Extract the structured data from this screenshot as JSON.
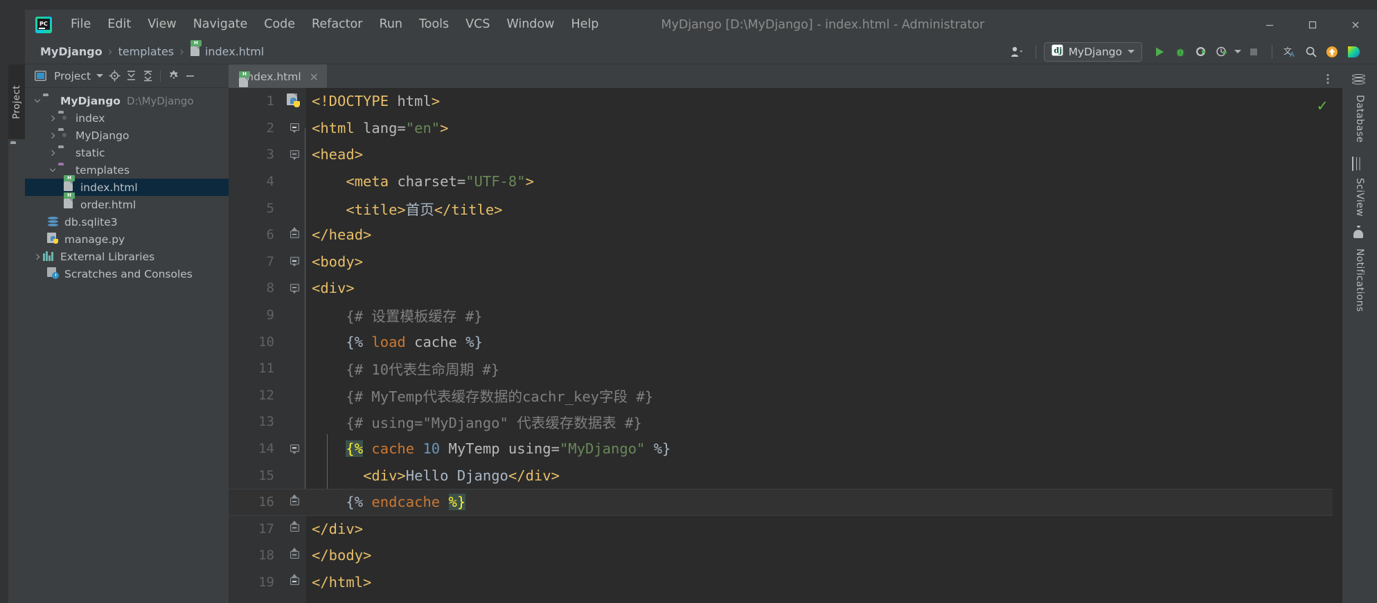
{
  "window": {
    "title": "MyDjango [D:\\MyDjango] - index.html - Administrator",
    "minimize": "–",
    "maximize": "□",
    "close": "✕",
    "logo_icon": "pycharm-logo-icon"
  },
  "menu": {
    "items": [
      {
        "label": "File",
        "mnemonic": "F"
      },
      {
        "label": "Edit",
        "mnemonic": "E"
      },
      {
        "label": "View",
        "mnemonic": "V"
      },
      {
        "label": "Navigate",
        "mnemonic": "N"
      },
      {
        "label": "Code",
        "mnemonic": "C"
      },
      {
        "label": "Refactor",
        "mnemonic": "R"
      },
      {
        "label": "Run",
        "mnemonic": "u"
      },
      {
        "label": "Tools",
        "mnemonic": "T"
      },
      {
        "label": "VCS",
        "mnemonic": "S"
      },
      {
        "label": "Window",
        "mnemonic": "W"
      },
      {
        "label": "Help",
        "mnemonic": "H"
      }
    ]
  },
  "breadcrumb": {
    "separator": "›",
    "items": [
      {
        "label": "MyDjango",
        "bold": true,
        "icon": ""
      },
      {
        "label": "templates",
        "bold": false,
        "icon": ""
      },
      {
        "label": "index.html",
        "bold": false,
        "icon": "html-file-icon"
      }
    ]
  },
  "toolbar": {
    "user_icon": "user-account-icon",
    "run_config": {
      "label": "MyDjango",
      "icon": "django-config-icon"
    },
    "run_icon": "run-play-icon",
    "debug_icon": "debug-bug-icon",
    "coverage_icon": "run-coverage-icon",
    "profile_icon": "run-profiler-icon",
    "stop_icon": "stop-icon",
    "translate_icon": "translate-icon",
    "search_icon": "search-everywhere-icon",
    "update_icon": "update-project-icon",
    "ide_icon": "ide-feature-icon"
  },
  "left_strip": {
    "tab_label": "Project",
    "folder_icon": "folder-icon"
  },
  "project_panel": {
    "header": {
      "title": "Project",
      "project_icon": "project-view-icon",
      "dropdown_icon": "chevron-down-icon",
      "locate_icon": "scroll-from-source-icon",
      "expand_icon": "expand-all-icon",
      "collapse_icon": "collapse-all-icon",
      "settings_icon": "gear-icon",
      "hide_icon": "minimize-icon"
    },
    "tree": [
      {
        "label": "MyDjango",
        "path": "D:\\MyDjango",
        "indent": 0,
        "arrow": "open",
        "icon": "folder-icon",
        "bold": true,
        "selected": false
      },
      {
        "label": "index",
        "path": "",
        "indent": 1,
        "arrow": "closed",
        "icon": "module-folder-icon",
        "bold": false,
        "selected": false
      },
      {
        "label": "MyDjango",
        "path": "",
        "indent": 1,
        "arrow": "closed",
        "icon": "module-folder-icon",
        "bold": false,
        "selected": false
      },
      {
        "label": "static",
        "path": "",
        "indent": 1,
        "arrow": "closed",
        "icon": "folder-icon",
        "bold": false,
        "selected": false
      },
      {
        "label": "templates",
        "path": "",
        "indent": 1,
        "arrow": "open",
        "icon": "templates-folder-icon",
        "bold": false,
        "selected": false
      },
      {
        "label": "index.html",
        "path": "",
        "indent": 2,
        "arrow": "none",
        "icon": "html-file-icon",
        "bold": false,
        "selected": true
      },
      {
        "label": "order.html",
        "path": "",
        "indent": 2,
        "arrow": "none",
        "icon": "html-file-icon",
        "bold": false,
        "selected": false
      },
      {
        "label": "db.sqlite3",
        "path": "",
        "indent": 1,
        "arrow": "none",
        "icon": "database-file-icon",
        "bold": false,
        "selected": false
      },
      {
        "label": "manage.py",
        "path": "",
        "indent": 1,
        "arrow": "none",
        "icon": "python-file-icon",
        "bold": false,
        "selected": false
      },
      {
        "label": "External Libraries",
        "path": "",
        "indent": 0,
        "arrow": "closed",
        "icon": "external-libraries-icon",
        "bold": false,
        "selected": false
      },
      {
        "label": "Scratches and Consoles",
        "path": "",
        "indent": 0,
        "arrow": "none",
        "icon": "scratches-icon",
        "bold": false,
        "selected": false
      }
    ]
  },
  "editor": {
    "tab": {
      "label": "index.html",
      "icon": "html-file-icon",
      "close": "✕"
    },
    "more_icon": "more-options-icon",
    "inspection_status": "✓",
    "lines": [
      {
        "num": "1",
        "fold": "none",
        "gutter": "django-python-icon",
        "caret": false,
        "tokens": [
          {
            "t": "<!DOCTYPE ",
            "c": "s-tag"
          },
          {
            "t": "html",
            "c": "s-attr"
          },
          {
            "t": ">",
            "c": "s-tag"
          }
        ]
      },
      {
        "num": "2",
        "fold": "down",
        "gutter": "",
        "caret": false,
        "tokens": [
          {
            "t": "<html ",
            "c": "s-tag"
          },
          {
            "t": "lang=",
            "c": "s-attr"
          },
          {
            "t": "\"en\"",
            "c": "s-val"
          },
          {
            "t": ">",
            "c": "s-tag"
          }
        ]
      },
      {
        "num": "3",
        "fold": "down",
        "gutter": "",
        "caret": false,
        "tokens": [
          {
            "t": "<head>",
            "c": "s-tag"
          }
        ]
      },
      {
        "num": "4",
        "fold": "none",
        "gutter": "",
        "caret": false,
        "tokens": [
          {
            "t": "    ",
            "c": "s-txt"
          },
          {
            "t": "<meta ",
            "c": "s-tag"
          },
          {
            "t": "charset=",
            "c": "s-attr"
          },
          {
            "t": "\"UTF-8\"",
            "c": "s-val"
          },
          {
            "t": ">",
            "c": "s-tag"
          }
        ]
      },
      {
        "num": "5",
        "fold": "none",
        "gutter": "",
        "caret": false,
        "tokens": [
          {
            "t": "    ",
            "c": "s-txt"
          },
          {
            "t": "<title>",
            "c": "s-tag"
          },
          {
            "t": "首页",
            "c": "s-txt"
          },
          {
            "t": "</title>",
            "c": "s-tag"
          }
        ]
      },
      {
        "num": "6",
        "fold": "up",
        "gutter": "",
        "caret": false,
        "tokens": [
          {
            "t": "</head>",
            "c": "s-tag"
          }
        ]
      },
      {
        "num": "7",
        "fold": "down",
        "gutter": "",
        "caret": false,
        "tokens": [
          {
            "t": "<body>",
            "c": "s-tag"
          }
        ]
      },
      {
        "num": "8",
        "fold": "down",
        "gutter": "",
        "caret": false,
        "tokens": [
          {
            "t": "<div>",
            "c": "s-tag"
          }
        ]
      },
      {
        "num": "9",
        "fold": "none",
        "gutter": "",
        "caret": false,
        "tokens": [
          {
            "t": "    {# 设置模板缓存 #}",
            "c": "s-com"
          }
        ]
      },
      {
        "num": "10",
        "fold": "none",
        "gutter": "",
        "caret": false,
        "tokens": [
          {
            "t": "    {% ",
            "c": "s-brace"
          },
          {
            "t": "load",
            "c": "s-kw"
          },
          {
            "t": " cache ",
            "c": "s-attr"
          },
          {
            "t": "%}",
            "c": "s-brace"
          }
        ]
      },
      {
        "num": "11",
        "fold": "none",
        "gutter": "",
        "caret": false,
        "tokens": [
          {
            "t": "    {# 10代表生命周期 #}",
            "c": "s-com"
          }
        ]
      },
      {
        "num": "12",
        "fold": "none",
        "gutter": "",
        "caret": false,
        "tokens": [
          {
            "t": "    {# MyTemp代表缓存数据的cachr_key字段 #}",
            "c": "s-com"
          }
        ]
      },
      {
        "num": "13",
        "fold": "none",
        "gutter": "",
        "caret": false,
        "tokens": [
          {
            "t": "    {# using=\"MyDjango\" 代表缓存数据表 #}",
            "c": "s-com"
          }
        ]
      },
      {
        "num": "14",
        "fold": "down",
        "gutter": "",
        "caret": false,
        "tokens": [
          {
            "t": "    ",
            "c": "s-txt"
          },
          {
            "t": "{%",
            "c": "hl-brace"
          },
          {
            "t": " ",
            "c": "s-txt"
          },
          {
            "t": "cache",
            "c": "s-kw"
          },
          {
            "t": " ",
            "c": "s-txt"
          },
          {
            "t": "10",
            "c": "s-num"
          },
          {
            "t": " MyTemp using=",
            "c": "s-attr"
          },
          {
            "t": "\"MyDjango\"",
            "c": "s-val"
          },
          {
            "t": " ",
            "c": "s-txt"
          },
          {
            "t": "%}",
            "c": "s-brace"
          }
        ]
      },
      {
        "num": "15",
        "fold": "none",
        "gutter": "",
        "caret": false,
        "tokens": [
          {
            "t": "      ",
            "c": "s-txt"
          },
          {
            "t": "<div>",
            "c": "s-tag"
          },
          {
            "t": "Hello Django",
            "c": "s-txt"
          },
          {
            "t": "</div>",
            "c": "s-tag"
          }
        ]
      },
      {
        "num": "16",
        "fold": "up",
        "gutter": "",
        "caret": true,
        "tokens": [
          {
            "t": "    {% ",
            "c": "s-brace"
          },
          {
            "t": "endcache",
            "c": "s-kw"
          },
          {
            "t": " ",
            "c": "s-txt"
          },
          {
            "t": "%}",
            "c": "hl-brace"
          }
        ]
      },
      {
        "num": "17",
        "fold": "up",
        "gutter": "",
        "caret": false,
        "tokens": [
          {
            "t": "</div>",
            "c": "s-tag"
          }
        ]
      },
      {
        "num": "18",
        "fold": "up",
        "gutter": "",
        "caret": false,
        "tokens": [
          {
            "t": "</body>",
            "c": "s-tag"
          }
        ]
      },
      {
        "num": "19",
        "fold": "up",
        "gutter": "",
        "caret": false,
        "tokens": [
          {
            "t": "</html>",
            "c": "s-tag"
          }
        ]
      }
    ]
  },
  "right_strip": {
    "items": [
      {
        "label": "Database",
        "icon": "database-icon"
      },
      {
        "label": "SciView",
        "icon": "sciview-grid-icon"
      },
      {
        "label": "Notifications",
        "icon": "bell-icon"
      }
    ]
  },
  "colors": {
    "bg_editor": "#2b2b2b",
    "bg_panel": "#3c3f41",
    "selection": "#0d293e",
    "tag": "#e8bf6a",
    "string": "#6a8759",
    "keyword": "#cc7832",
    "number": "#6897bb",
    "comment": "#808080",
    "text": "#a9b7c6",
    "accent_green": "#62b543"
  }
}
